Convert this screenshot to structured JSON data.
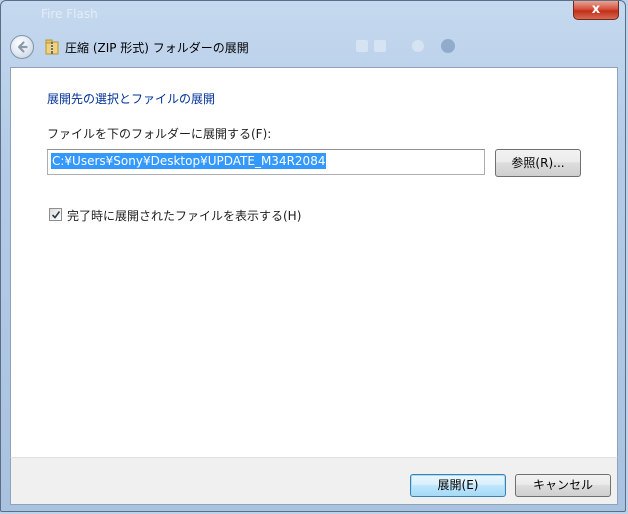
{
  "window": {
    "ghost_title": "Fire Flash",
    "close_label": "x"
  },
  "nav": {
    "title": "圧縮 (ZIP 形式) フォルダーの展開"
  },
  "content": {
    "heading": "展開先の選択とファイルの展開",
    "field_label": "ファイルを下のフォルダーに展開する(F):",
    "path_value": "C:¥Users¥Sony¥Desktop¥UPDATE_M34R2084",
    "browse_label": "参照(R)...",
    "checkbox_label": "完了時に展開されたファイルを表示する(H)",
    "checkbox_checked": true
  },
  "footer": {
    "extract_label": "展開(E)",
    "cancel_label": "キャンセル"
  },
  "colors": {
    "heading": "#003399",
    "selection": "#3399ff",
    "close": "#c1301b"
  },
  "icons": {
    "back": "back-arrow-icon",
    "folder": "zip-folder-icon",
    "check": "checkmark-icon"
  }
}
